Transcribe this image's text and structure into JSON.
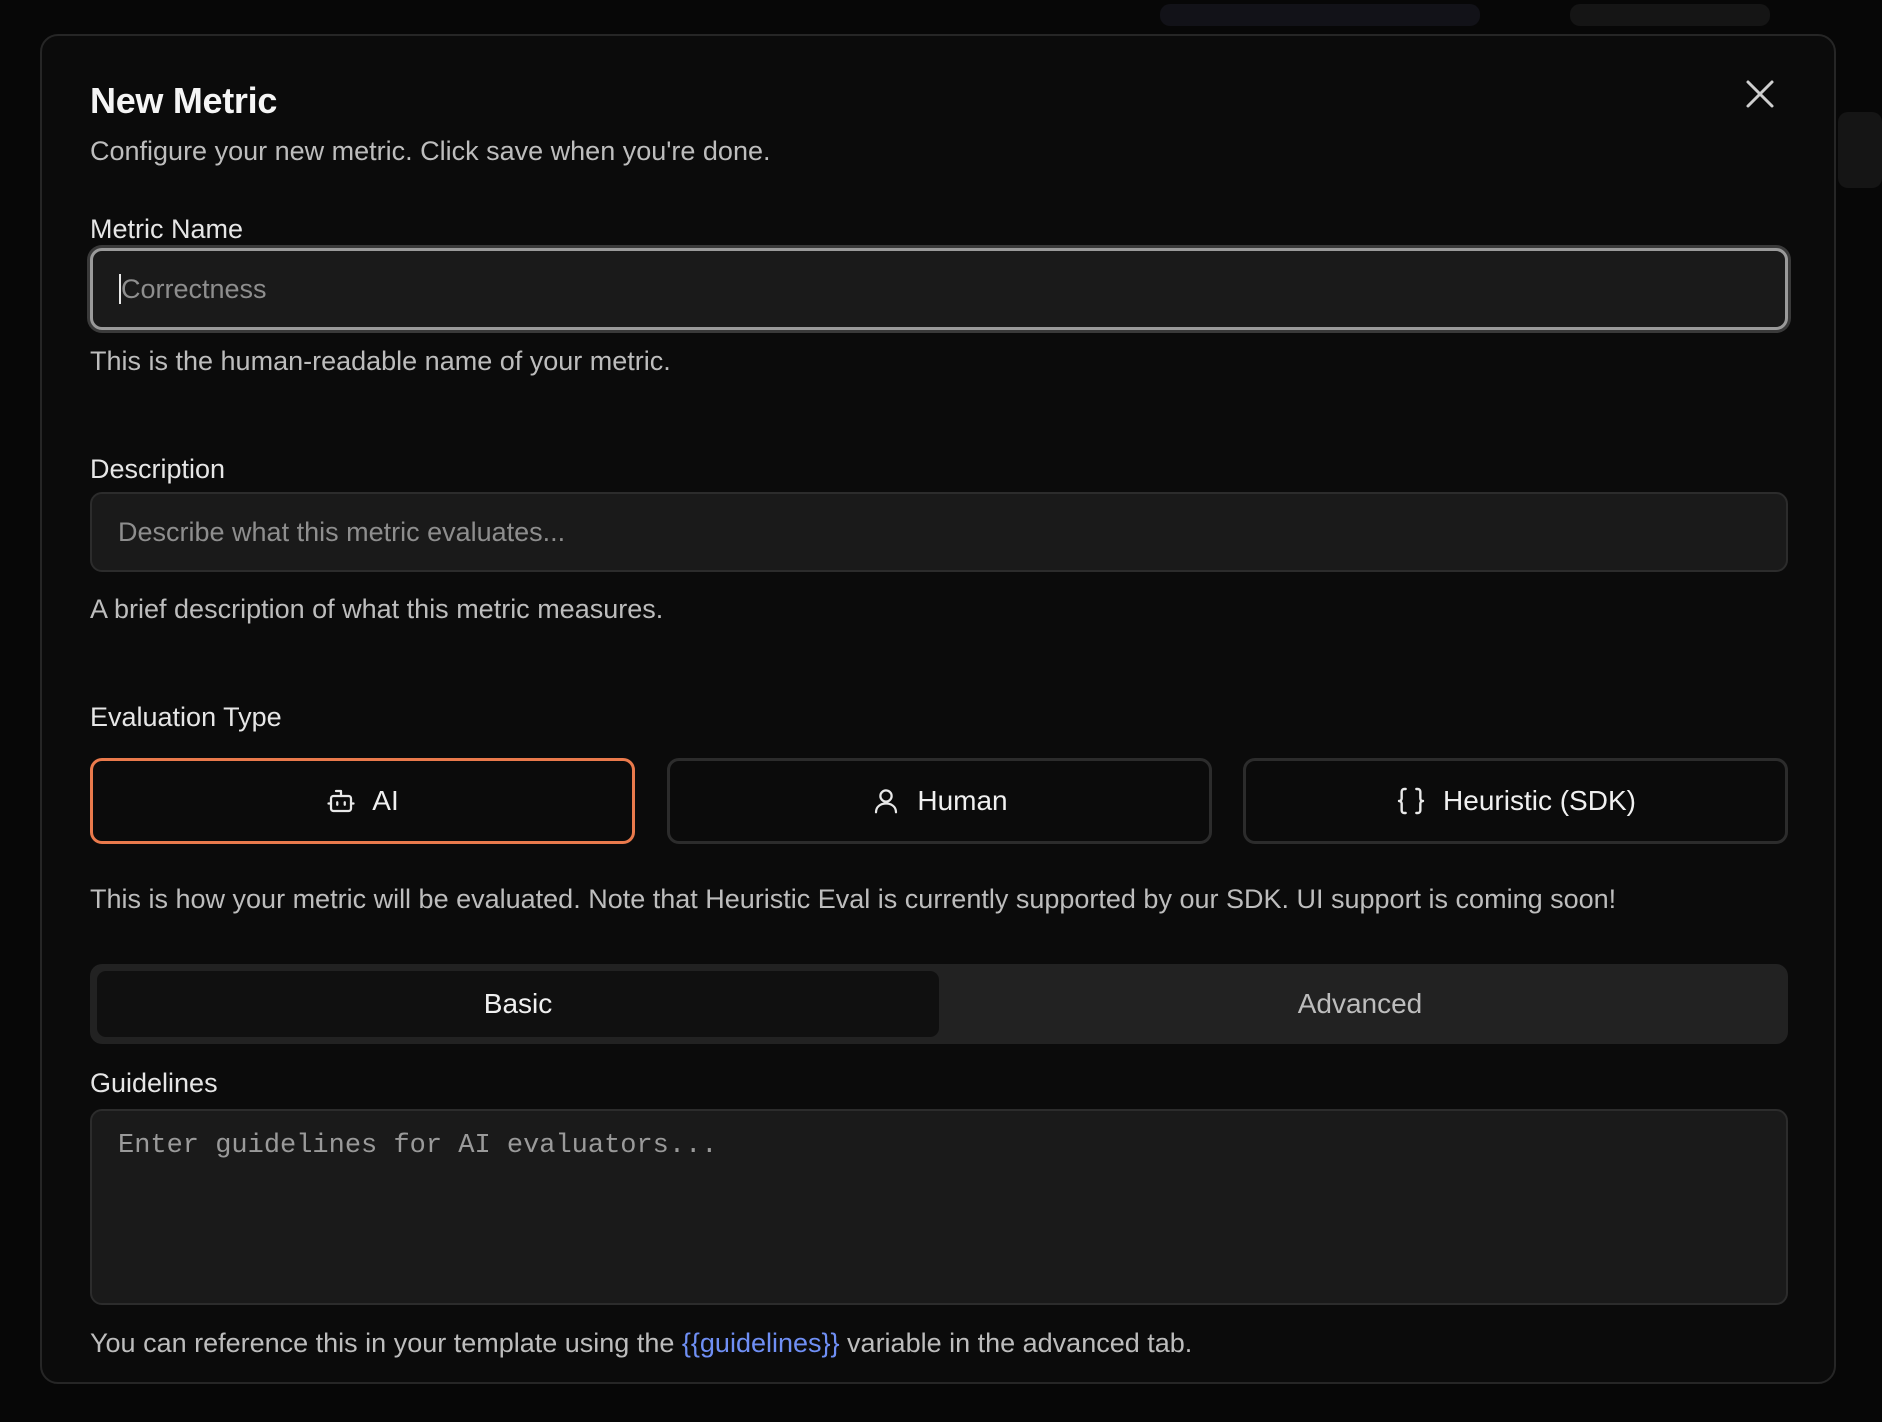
{
  "dialog": {
    "title": "New Metric",
    "subtitle": "Configure your new metric. Click save when you're done.",
    "close_icon": "x-icon"
  },
  "metric_name": {
    "label": "Metric Name",
    "placeholder": "Correctness",
    "value": "",
    "helper": "This is the human-readable name of your metric."
  },
  "description": {
    "label": "Description",
    "placeholder": "Describe what this metric evaluates...",
    "value": "",
    "helper": "A brief description of what this metric measures."
  },
  "evaluation_type": {
    "label": "Evaluation Type",
    "options": [
      {
        "label": "AI",
        "icon": "bot-icon",
        "selected": true
      },
      {
        "label": "Human",
        "icon": "user-icon",
        "selected": false
      },
      {
        "label": "Heuristic (SDK)",
        "icon": "braces-icon",
        "selected": false
      }
    ],
    "helper": "This is how your metric will be evaluated. Note that Heuristic Eval is currently supported by our SDK. UI support is coming soon!"
  },
  "tabs": [
    {
      "label": "Basic",
      "active": true
    },
    {
      "label": "Advanced",
      "active": false
    }
  ],
  "guidelines": {
    "label": "Guidelines",
    "placeholder": "Enter guidelines for AI evaluators...",
    "value": "",
    "helper_prefix": "You can reference this in your template using the ",
    "helper_variable": "{{guidelines}}",
    "helper_suffix": " variable in the advanced tab."
  },
  "colors": {
    "selected_border": "#ea7a4c",
    "variable_link": "#6f8ff5",
    "modal_bg": "#0b0b0b",
    "input_bg": "#1a1a1a"
  }
}
